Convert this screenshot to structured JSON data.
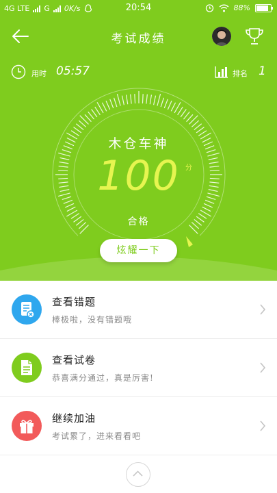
{
  "status_bar": {
    "network": "4G LTE",
    "network2": "G",
    "speed": "0K/s",
    "time": "20:54",
    "battery": "88%"
  },
  "header": {
    "title": "考试成绩"
  },
  "stats": {
    "time_label": "用时",
    "time_value": "05:57",
    "rank_label": "排名",
    "rank_value": "1"
  },
  "score": {
    "title": "木仓车神",
    "value": "100",
    "unit": "分",
    "result": "合格",
    "share_label": "炫耀一下"
  },
  "menu": [
    {
      "title": "查看错题",
      "subtitle": "棒极啦，没有错题哦",
      "icon": "wrong-questions-icon",
      "color": "#2fa7ee"
    },
    {
      "title": "查看试卷",
      "subtitle": "恭喜满分通过，真是厉害!",
      "icon": "exam-paper-icon",
      "color": "#7fcc1e"
    },
    {
      "title": "继续加油",
      "subtitle": "考试累了，进来看看吧",
      "icon": "gift-icon",
      "color": "#f25a5a"
    }
  ],
  "colors": {
    "accent_green": "#7fcc1e",
    "score_yellow": "#e6f550"
  }
}
